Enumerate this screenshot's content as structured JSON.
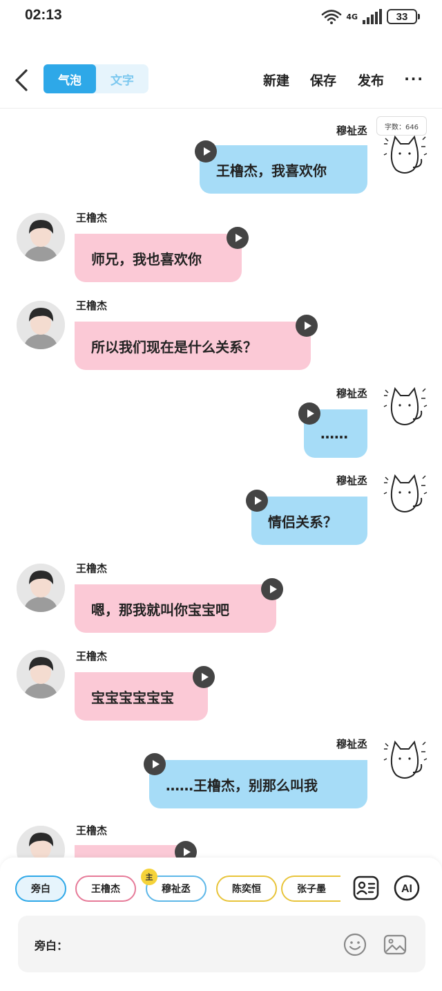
{
  "status": {
    "time": "02:13",
    "network": "4G",
    "battery": "33"
  },
  "toolbar": {
    "tab_bubble": "气泡",
    "tab_text": "文字",
    "new_label": "新建",
    "save_label": "保存",
    "publish_label": "发布",
    "more_label": "···"
  },
  "word_count": "字数：646",
  "messages": [
    {
      "sender": "穆祉丞",
      "text": "王橹杰，我喜欢你"
    },
    {
      "sender": "王橹杰",
      "text": "师兄，我也喜欢你"
    },
    {
      "sender": "王橹杰",
      "text": "所以我们现在是什么关系？"
    },
    {
      "sender": "穆祉丞",
      "text": "……"
    },
    {
      "sender": "穆祉丞",
      "text": "情侣关系？"
    },
    {
      "sender": "王橹杰",
      "text": "嗯，那我就叫你宝宝吧"
    },
    {
      "sender": "王橹杰",
      "text": "宝宝宝宝宝宝"
    },
    {
      "sender": "穆祉丞",
      "text": "……王橹杰，别那么叫我"
    },
    {
      "sender": "王橹杰",
      "text": ""
    }
  ],
  "characters": {
    "narrator": "旁白",
    "wang": "王橹杰",
    "mu": "穆祉丞",
    "chen": "陈奕恒",
    "zhang": "张子墨",
    "main_badge": "主"
  },
  "composer": {
    "label": "旁白：",
    "placeholder": ""
  },
  "icons": {
    "back": "chevron-left-icon",
    "play": "play-icon",
    "character": "character-card-icon",
    "ai": "ai-icon",
    "emoji": "smiley-icon",
    "image": "image-icon"
  },
  "colors": {
    "accent": "#2ea8e8",
    "pink_bubble": "#fbc9d6",
    "blue_bubble": "#a6dcf7"
  }
}
